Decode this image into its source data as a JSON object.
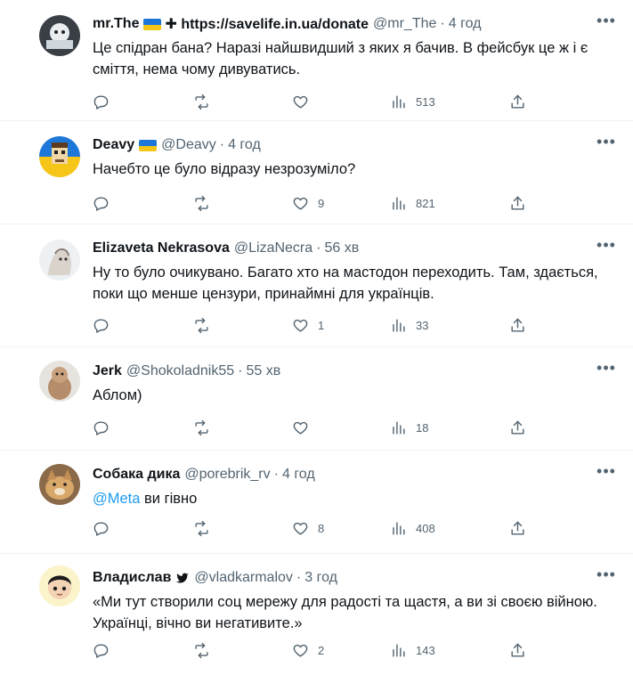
{
  "replies": [
    {
      "name": "mr.The",
      "extra": "✚ https://savelife.in.ua/donate",
      "handle": "@mr_The",
      "time": "4 год",
      "text": "Це спідран бана? Наразі найшвидший з яких я бачив. В фейсбук це ж і є сміття, нема чому дивуватись.",
      "likes": "",
      "views": "513"
    },
    {
      "name": "Deavy",
      "handle": "@Deavy",
      "time": "4 год",
      "text": "Начебто це було відразу незрозуміло?",
      "likes": "9",
      "views": "821"
    },
    {
      "name": "Elizaveta Nekrasova",
      "handle": "@LizaNecra",
      "time": "56 хв",
      "text": "Ну то було очикувано. Багато хто на мастодон переходить. Там, здається, поки що менше цензури, принаймні для українців.",
      "likes": "1",
      "views": "33"
    },
    {
      "name": "Jerk",
      "handle": "@Shokoladnik55",
      "time": "55 хв",
      "text": "Аблом)",
      "likes": "",
      "views": "18"
    },
    {
      "name": "Собака дика",
      "handle": "@porebrik_rv",
      "time": "4 год",
      "mention": "@Meta",
      "text_rest": " ви гівно",
      "likes": "8",
      "views": "408"
    },
    {
      "name": "Владислав",
      "badge": "🐦",
      "handle": "@vladkarmalov",
      "time": "3 год",
      "text": "«Ми тут створили соц мережу для радості та щастя, а ви зі своєю війною. Українці, вічно ви негативите.»",
      "likes": "2",
      "views": "143"
    }
  ],
  "icons": {
    "reply": "reply-icon",
    "retweet": "retweet-icon",
    "like": "heart-icon",
    "views": "views-icon",
    "share": "share-icon",
    "more": "more-icon"
  },
  "colors": {
    "text": "#0f1419",
    "muted": "#536471",
    "link": "#1d9bf0",
    "divider": "#eff3f4"
  }
}
